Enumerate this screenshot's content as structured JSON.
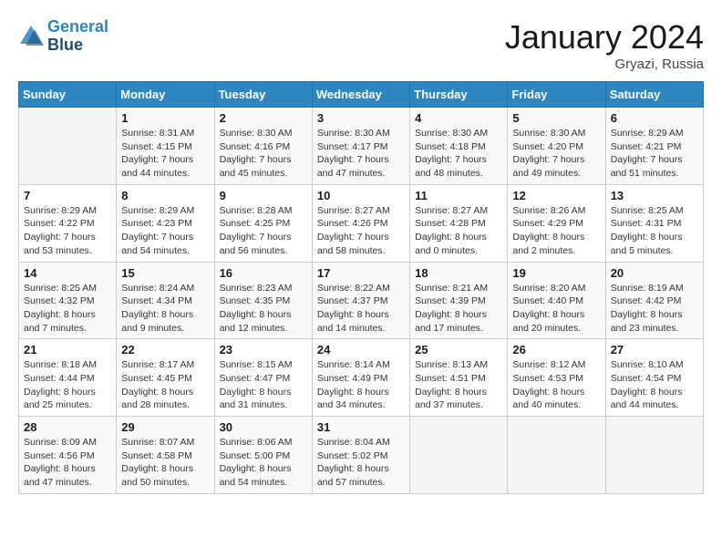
{
  "header": {
    "logo_line1": "General",
    "logo_line2": "Blue",
    "month": "January 2024",
    "location": "Gryazi, Russia"
  },
  "weekdays": [
    "Sunday",
    "Monday",
    "Tuesday",
    "Wednesday",
    "Thursday",
    "Friday",
    "Saturday"
  ],
  "weeks": [
    [
      {
        "day": "",
        "info": ""
      },
      {
        "day": "1",
        "info": "Sunrise: 8:31 AM\nSunset: 4:15 PM\nDaylight: 7 hours\nand 44 minutes."
      },
      {
        "day": "2",
        "info": "Sunrise: 8:30 AM\nSunset: 4:16 PM\nDaylight: 7 hours\nand 45 minutes."
      },
      {
        "day": "3",
        "info": "Sunrise: 8:30 AM\nSunset: 4:17 PM\nDaylight: 7 hours\nand 47 minutes."
      },
      {
        "day": "4",
        "info": "Sunrise: 8:30 AM\nSunset: 4:18 PM\nDaylight: 7 hours\nand 48 minutes."
      },
      {
        "day": "5",
        "info": "Sunrise: 8:30 AM\nSunset: 4:20 PM\nDaylight: 7 hours\nand 49 minutes."
      },
      {
        "day": "6",
        "info": "Sunrise: 8:29 AM\nSunset: 4:21 PM\nDaylight: 7 hours\nand 51 minutes."
      }
    ],
    [
      {
        "day": "7",
        "info": "Sunrise: 8:29 AM\nSunset: 4:22 PM\nDaylight: 7 hours\nand 53 minutes."
      },
      {
        "day": "8",
        "info": "Sunrise: 8:29 AM\nSunset: 4:23 PM\nDaylight: 7 hours\nand 54 minutes."
      },
      {
        "day": "9",
        "info": "Sunrise: 8:28 AM\nSunset: 4:25 PM\nDaylight: 7 hours\nand 56 minutes."
      },
      {
        "day": "10",
        "info": "Sunrise: 8:27 AM\nSunset: 4:26 PM\nDaylight: 7 hours\nand 58 minutes."
      },
      {
        "day": "11",
        "info": "Sunrise: 8:27 AM\nSunset: 4:28 PM\nDaylight: 8 hours\nand 0 minutes."
      },
      {
        "day": "12",
        "info": "Sunrise: 8:26 AM\nSunset: 4:29 PM\nDaylight: 8 hours\nand 2 minutes."
      },
      {
        "day": "13",
        "info": "Sunrise: 8:25 AM\nSunset: 4:31 PM\nDaylight: 8 hours\nand 5 minutes."
      }
    ],
    [
      {
        "day": "14",
        "info": "Sunrise: 8:25 AM\nSunset: 4:32 PM\nDaylight: 8 hours\nand 7 minutes."
      },
      {
        "day": "15",
        "info": "Sunrise: 8:24 AM\nSunset: 4:34 PM\nDaylight: 8 hours\nand 9 minutes."
      },
      {
        "day": "16",
        "info": "Sunrise: 8:23 AM\nSunset: 4:35 PM\nDaylight: 8 hours\nand 12 minutes."
      },
      {
        "day": "17",
        "info": "Sunrise: 8:22 AM\nSunset: 4:37 PM\nDaylight: 8 hours\nand 14 minutes."
      },
      {
        "day": "18",
        "info": "Sunrise: 8:21 AM\nSunset: 4:39 PM\nDaylight: 8 hours\nand 17 minutes."
      },
      {
        "day": "19",
        "info": "Sunrise: 8:20 AM\nSunset: 4:40 PM\nDaylight: 8 hours\nand 20 minutes."
      },
      {
        "day": "20",
        "info": "Sunrise: 8:19 AM\nSunset: 4:42 PM\nDaylight: 8 hours\nand 23 minutes."
      }
    ],
    [
      {
        "day": "21",
        "info": "Sunrise: 8:18 AM\nSunset: 4:44 PM\nDaylight: 8 hours\nand 25 minutes."
      },
      {
        "day": "22",
        "info": "Sunrise: 8:17 AM\nSunset: 4:45 PM\nDaylight: 8 hours\nand 28 minutes."
      },
      {
        "day": "23",
        "info": "Sunrise: 8:15 AM\nSunset: 4:47 PM\nDaylight: 8 hours\nand 31 minutes."
      },
      {
        "day": "24",
        "info": "Sunrise: 8:14 AM\nSunset: 4:49 PM\nDaylight: 8 hours\nand 34 minutes."
      },
      {
        "day": "25",
        "info": "Sunrise: 8:13 AM\nSunset: 4:51 PM\nDaylight: 8 hours\nand 37 minutes."
      },
      {
        "day": "26",
        "info": "Sunrise: 8:12 AM\nSunset: 4:53 PM\nDaylight: 8 hours\nand 40 minutes."
      },
      {
        "day": "27",
        "info": "Sunrise: 8:10 AM\nSunset: 4:54 PM\nDaylight: 8 hours\nand 44 minutes."
      }
    ],
    [
      {
        "day": "28",
        "info": "Sunrise: 8:09 AM\nSunset: 4:56 PM\nDaylight: 8 hours\nand 47 minutes."
      },
      {
        "day": "29",
        "info": "Sunrise: 8:07 AM\nSunset: 4:58 PM\nDaylight: 8 hours\nand 50 minutes."
      },
      {
        "day": "30",
        "info": "Sunrise: 8:06 AM\nSunset: 5:00 PM\nDaylight: 8 hours\nand 54 minutes."
      },
      {
        "day": "31",
        "info": "Sunrise: 8:04 AM\nSunset: 5:02 PM\nDaylight: 8 hours\nand 57 minutes."
      },
      {
        "day": "",
        "info": ""
      },
      {
        "day": "",
        "info": ""
      },
      {
        "day": "",
        "info": ""
      }
    ]
  ]
}
